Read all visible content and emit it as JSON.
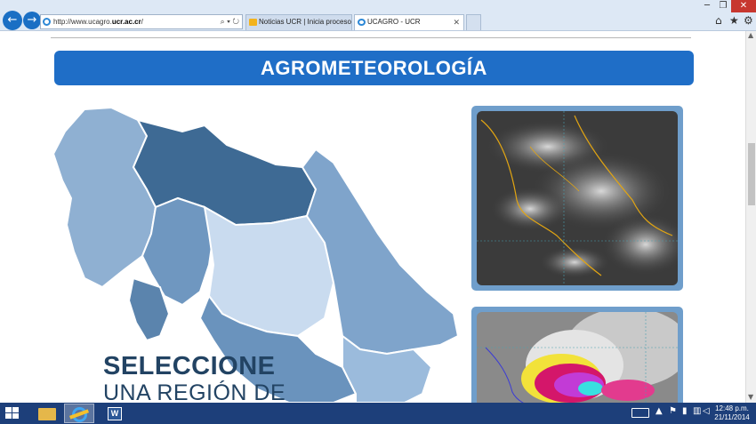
{
  "browser": {
    "address": {
      "prefix": "http://www.ucagro.",
      "bold": "ucr.ac.cr",
      "suffix": "/",
      "tools": "⌕ ▾ ↻"
    },
    "tabs": [
      {
        "label": "Noticias UCR | Inicia proceso d...",
        "active": false
      },
      {
        "label": "UCAGRO - UCR",
        "active": true
      }
    ],
    "tab_close": "✕",
    "window_controls": {
      "minimize": "─",
      "maximize": "❐",
      "close": "✕"
    },
    "toolbar_icons": {
      "home": "⌂",
      "favorites": "★",
      "settings": "⚙"
    }
  },
  "page": {
    "banner": "AGROMETEOROLOGÍA",
    "select_title": "SELECCIONE",
    "select_subtitle": "UNA REGIÓN DE"
  },
  "scrollbar": {
    "up": "▲",
    "down": "▼"
  },
  "taskbar": {
    "apps": [
      "file-explorer",
      "internet-explorer",
      "word"
    ],
    "word_letter": "W",
    "tray_icons": {
      "caret": "▲",
      "flag": "⚑",
      "power": "▮",
      "network": "▥",
      "volume": "◁"
    },
    "clock": {
      "time": "12:48 p.m.",
      "date": "21/11/2014"
    }
  },
  "colors": {
    "banner": "#1f6ec7",
    "map_light": "#c9dbef",
    "map_mid": "#8fb0d2",
    "map_dark": "#3e6a94",
    "headline": "#224363",
    "taskbar": "#1d3f7a"
  }
}
